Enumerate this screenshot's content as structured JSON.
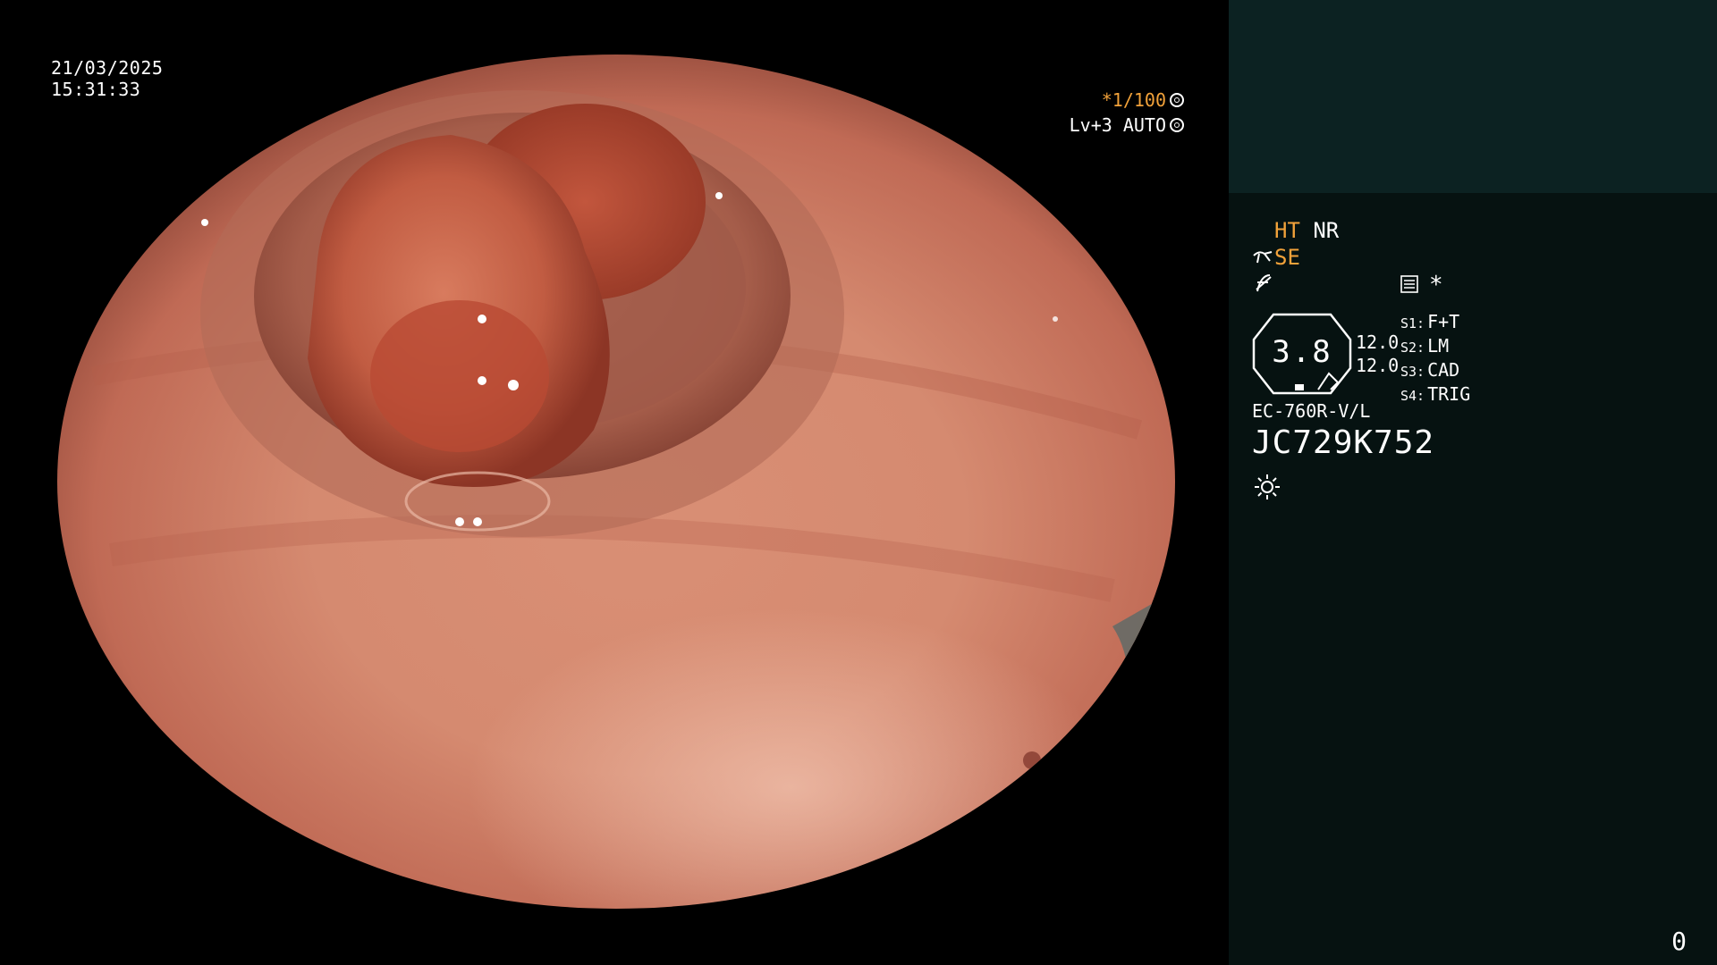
{
  "overlay": {
    "date": "21/03/2025",
    "time": "15:31:33",
    "shutter": "*1/100",
    "level": "Lv+3 AUTO"
  },
  "panel": {
    "ht": "HT",
    "nr": "NR",
    "se": "SE",
    "star": "*",
    "gauge_value": "3.8",
    "gauge_side_top": "12.0",
    "gauge_side_bottom": "12.0",
    "slots": [
      {
        "key": "S1:",
        "value": "F+T"
      },
      {
        "key": "S2:",
        "value": "LM"
      },
      {
        "key": "S3:",
        "value": "CAD"
      },
      {
        "key": "S4:",
        "value": "TRIG"
      }
    ],
    "scope_model": "EC-760R-V/L",
    "scope_serial": "JC729K752",
    "counter": "0"
  },
  "icons": {
    "shutter_icon": "aperture-icon",
    "level_icon": "target-icon",
    "se_icon": "scissor-icon",
    "filter_icon": "f-slash-icon",
    "menu_icon": "list-box-icon",
    "light_icon": "sun-icon"
  },
  "colors": {
    "accent": "#f2a23a",
    "panel_bg": "#061211",
    "panel_top_bg": "#0c2222"
  }
}
